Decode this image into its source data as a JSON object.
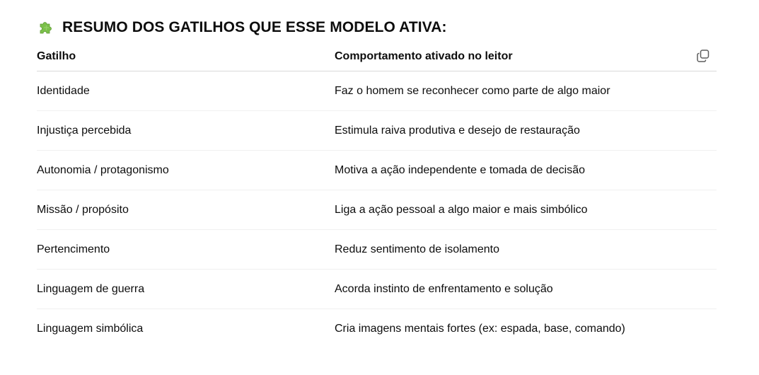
{
  "heading": {
    "icon": "puzzle-piece-icon",
    "icon_color": "#7bc04a",
    "title": "RESUMO DOS GATILHOS QUE ESSE MODELO ATIVA:"
  },
  "table": {
    "headers": [
      "Gatilho",
      "Comportamento ativado no leitor"
    ],
    "copy_icon": "copy-icon",
    "rows": [
      [
        "Identidade",
        "Faz o homem se reconhecer como parte de algo maior"
      ],
      [
        "Injustiça percebida",
        "Estimula raiva produtiva e desejo de restauração"
      ],
      [
        "Autonomia / protagonismo",
        "Motiva a ação independente e tomada de decisão"
      ],
      [
        "Missão / propósito",
        "Liga a ação pessoal a algo maior e mais simbólico"
      ],
      [
        "Pertencimento",
        "Reduz sentimento de isolamento"
      ],
      [
        "Linguagem de guerra",
        "Acorda instinto de enfrentamento e solução"
      ],
      [
        "Linguagem simbólica",
        "Cria imagens mentais fortes (ex: espada, base, comando)"
      ]
    ]
  }
}
